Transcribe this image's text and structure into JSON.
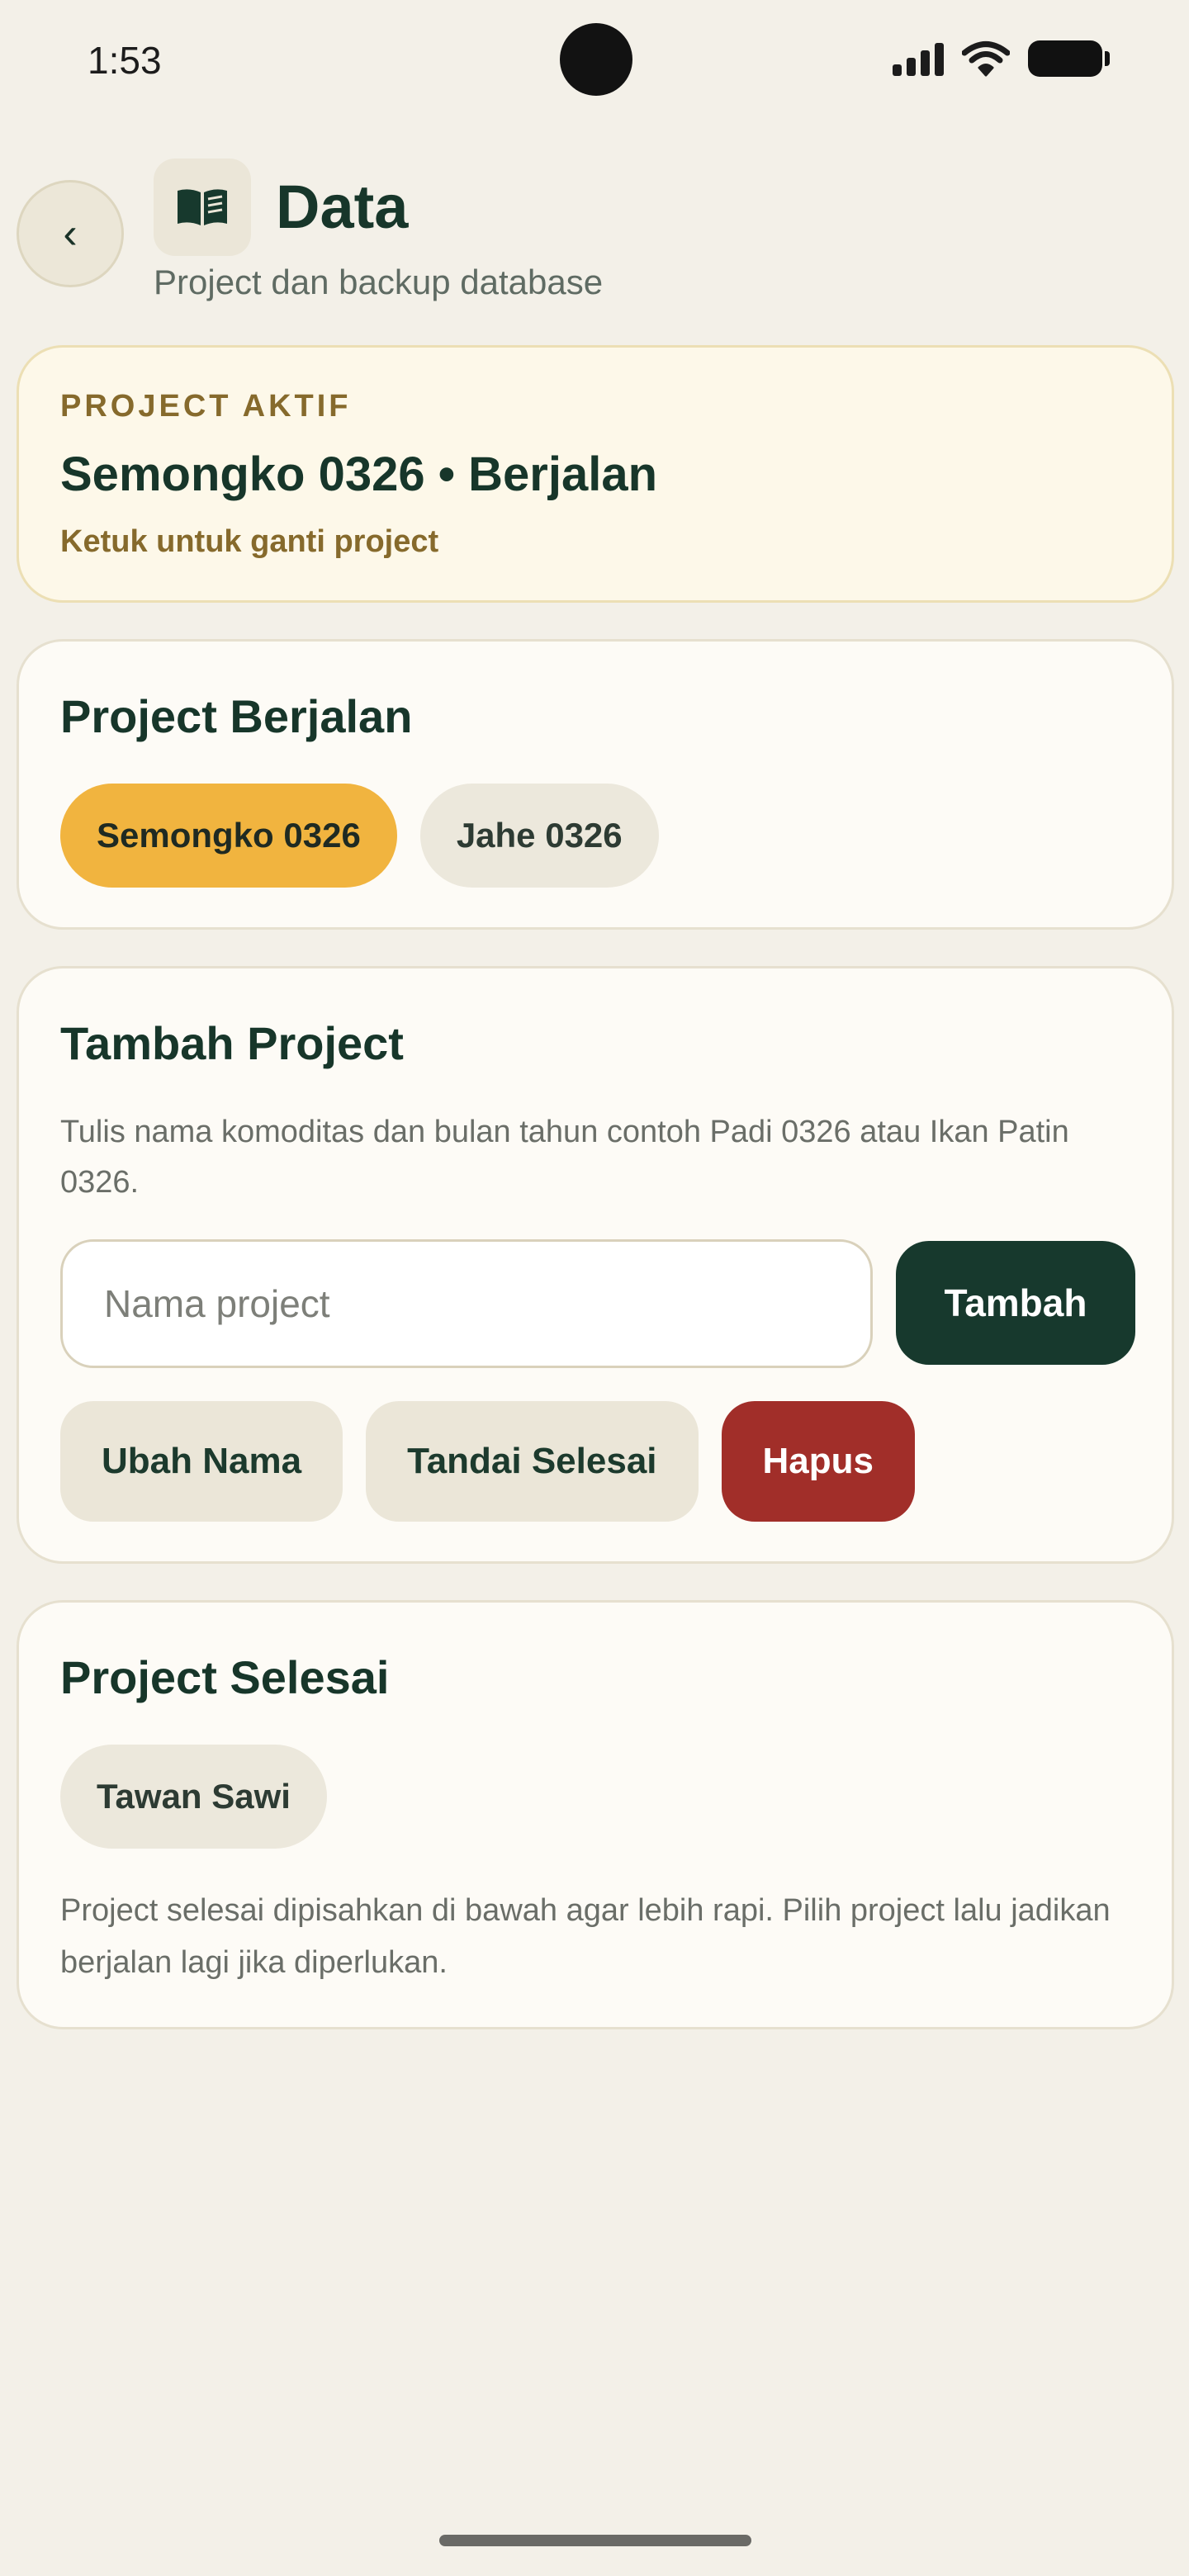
{
  "status_bar": {
    "time": "1:53",
    "icons": [
      "signal-icon",
      "wifi-icon",
      "battery-icon"
    ]
  },
  "header": {
    "back_label": "‹",
    "icon": "book-icon",
    "title": "Data",
    "subtitle": "Project dan backup database"
  },
  "active_project": {
    "label": "PROJECT AKTIF",
    "name": "Semongko 0326 • Berjalan",
    "hint": "Ketuk untuk ganti project"
  },
  "running_projects": {
    "title": "Project Berjalan",
    "items": [
      {
        "label": "Semongko 0326",
        "selected": true
      },
      {
        "label": "Jahe 0326",
        "selected": false
      }
    ]
  },
  "add_project": {
    "title": "Tambah Project",
    "description": "Tulis nama komoditas dan bulan tahun contoh Padi 0326 atau Ikan Patin 0326.",
    "input_placeholder": "Nama project",
    "input_value": "",
    "add_label": "Tambah",
    "actions": {
      "rename": "Ubah Nama",
      "mark_done": "Tandai Selesai",
      "delete": "Hapus"
    }
  },
  "done_projects": {
    "title": "Project Selesai",
    "items": [
      {
        "label": "Tawan Sawi"
      }
    ],
    "description": "Project selesai dipisahkan di bawah agar lebih rapi. Pilih project lalu jadikan berjalan lagi jika diperlukan."
  },
  "colors": {
    "background": "#f3f0e8",
    "primary_dark": "#17392d",
    "accent": "#f1b43f",
    "danger": "#a12e29",
    "active_label": "#866a2c"
  }
}
